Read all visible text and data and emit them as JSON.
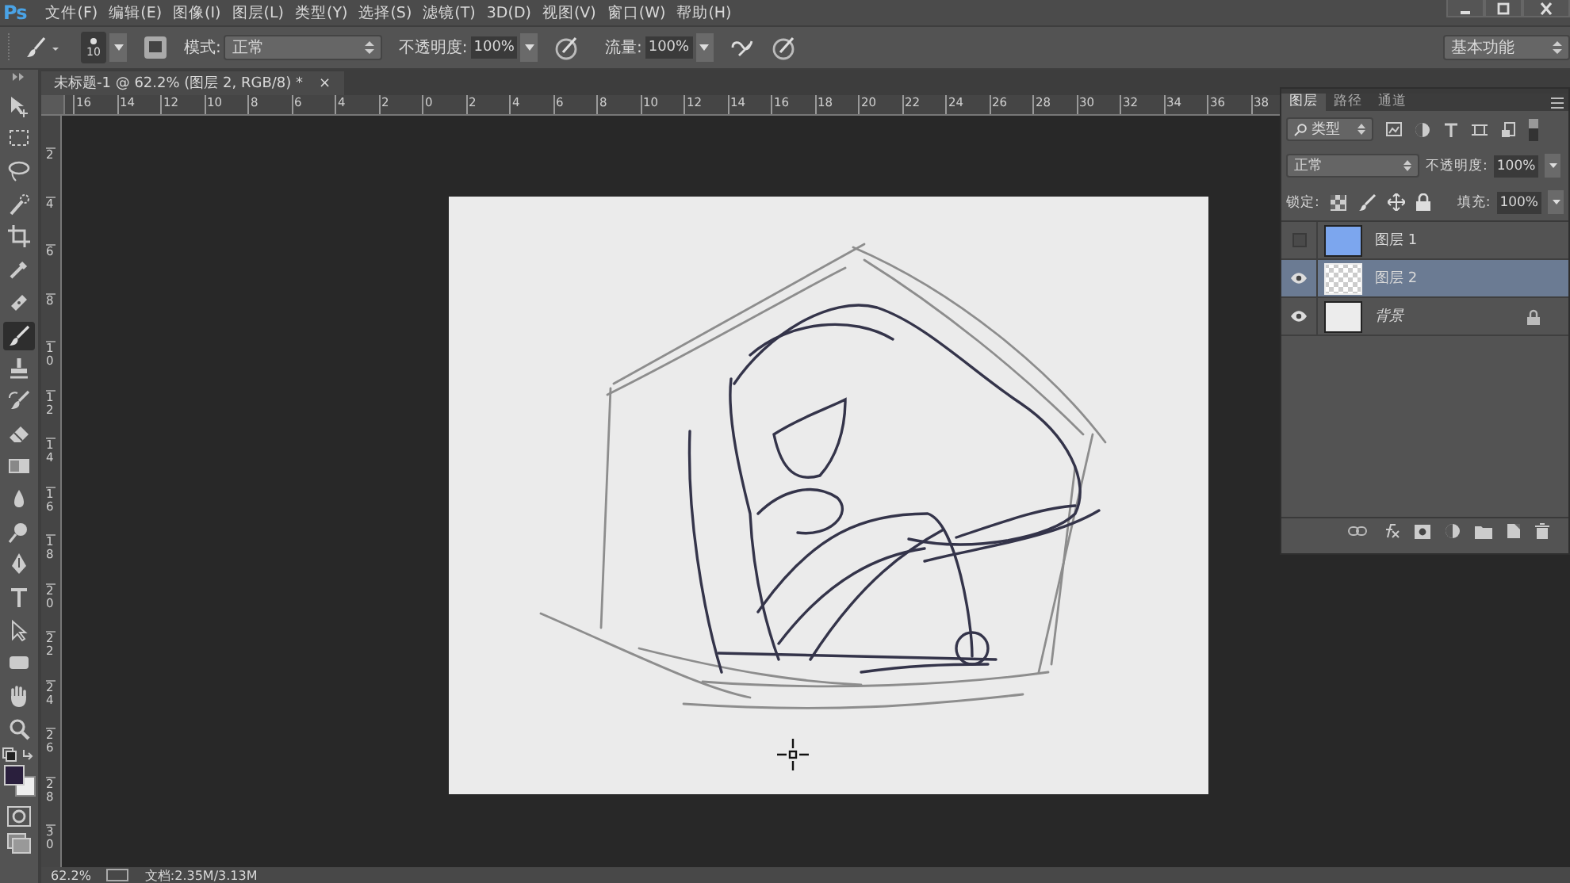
{
  "menu_bar": {
    "logo": "Ps",
    "items": [
      "文件(F)",
      "编辑(E)",
      "图像(I)",
      "图层(L)",
      "类型(Y)",
      "选择(S)",
      "滤镜(T)",
      "3D(D)",
      "视图(V)",
      "窗口(W)",
      "帮助(H)"
    ]
  },
  "options_bar": {
    "brush_size": "10",
    "mode_label": "模式:",
    "mode_value": "正常",
    "opacity_label": "不透明度:",
    "opacity_value": "100%",
    "flow_label": "流量:",
    "flow_value": "100%",
    "workspace": "基本功能"
  },
  "document_tab": {
    "title": "未标题-1 @ 62.2% (图层 2, RGB/8) *",
    "close": "×"
  },
  "rulers": {
    "horizontal": [
      "16",
      "14",
      "12",
      "10",
      "8",
      "6",
      "4",
      "2",
      "0",
      "2",
      "4",
      "6",
      "8",
      "10",
      "12",
      "14",
      "16",
      "18",
      "20",
      "22",
      "24",
      "26",
      "28",
      "30",
      "32",
      "34",
      "36",
      "38"
    ],
    "vertical": [
      "2",
      "4",
      "6",
      "8",
      "10",
      "12",
      "14",
      "16",
      "18",
      "20",
      "22",
      "24",
      "26",
      "28",
      "30"
    ]
  },
  "toolbar": {
    "tools": [
      {
        "kind": "move",
        "selected": false
      },
      {
        "kind": "marquee",
        "selected": false
      },
      {
        "kind": "lasso",
        "selected": false
      },
      {
        "kind": "quick-select",
        "selected": false
      },
      {
        "kind": "crop",
        "selected": false
      },
      {
        "kind": "eyedropper",
        "selected": false
      },
      {
        "kind": "healing",
        "selected": false
      },
      {
        "kind": "brush",
        "selected": true
      },
      {
        "kind": "stamp",
        "selected": false
      },
      {
        "kind": "history-brush",
        "selected": false
      },
      {
        "kind": "eraser",
        "selected": false
      },
      {
        "kind": "gradient",
        "selected": false
      },
      {
        "kind": "blur",
        "selected": false
      },
      {
        "kind": "dodge",
        "selected": false
      },
      {
        "kind": "pen",
        "selected": false
      },
      {
        "kind": "type",
        "selected": false
      },
      {
        "kind": "path-select",
        "selected": false
      },
      {
        "kind": "shape",
        "selected": false
      },
      {
        "kind": "hand",
        "selected": false
      },
      {
        "kind": "zoom",
        "selected": false
      }
    ]
  },
  "layers_panel": {
    "tabs": [
      {
        "label": "图层",
        "selected": true
      },
      {
        "label": "路径",
        "selected": false
      },
      {
        "label": "通道",
        "selected": false
      }
    ],
    "filter": "类型",
    "blend_mode": "正常",
    "opacity_label": "不透明度:",
    "opacity_value": "100%",
    "lock_label": "锁定:",
    "fill_label": "填充:",
    "fill_value": "100%",
    "layers": [
      {
        "name": "图层 1",
        "visible": false,
        "selected": false,
        "kind": "color",
        "locked": false
      },
      {
        "name": "图层 2",
        "visible": true,
        "selected": true,
        "kind": "transparent",
        "locked": false
      },
      {
        "name": "背景",
        "visible": true,
        "selected": false,
        "kind": "white",
        "locked": true
      }
    ]
  },
  "status_bar": {
    "zoom": "62.2%",
    "doc_info": "文档:2.35M/3.13M"
  }
}
